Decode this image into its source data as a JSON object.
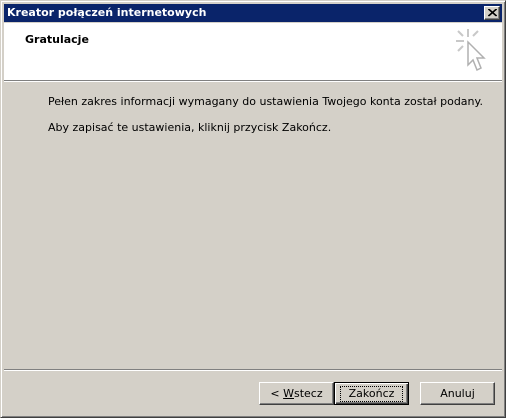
{
  "window": {
    "title": "Kreator połączeń internetowych"
  },
  "header": {
    "title": "Gratulacje",
    "icon": "wizard-cursor-icon"
  },
  "content": {
    "line1": "Pełen zakres informacji wymagany do ustawienia Twojego konta został podany.",
    "line2": "Aby zapisać te ustawienia, kliknij przycisk Zakończ."
  },
  "buttons": {
    "back_prefix": "< ",
    "back_accel": "W",
    "back_rest": "stecz",
    "finish": "Zakończ",
    "cancel": "Anuluj"
  },
  "colors": {
    "titlebar": "#0a246a",
    "face": "#d4d0c8",
    "header_bg": "#ffffff"
  }
}
